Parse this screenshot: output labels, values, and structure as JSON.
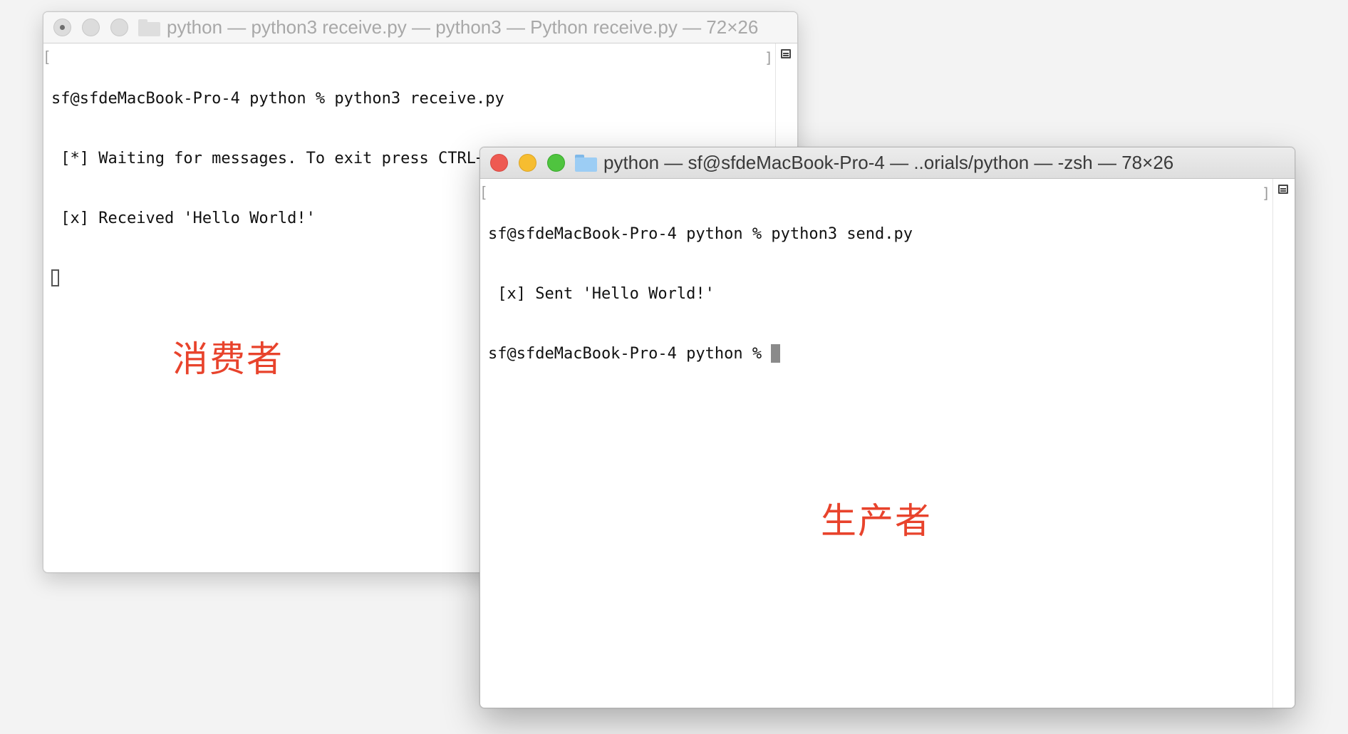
{
  "receiver_window": {
    "title": "python — python3 receive.py — python3 — Python receive.py — 72×26",
    "lines": [
      "sf@sfdeMacBook-Pro-4 python % python3 receive.py",
      " [*] Waiting for messages. To exit press CTRL+C",
      " [x] Received 'Hello World!'"
    ]
  },
  "sender_window": {
    "title": "python — sf@sfdeMacBook-Pro-4 — ..orials/python — -zsh — 78×26",
    "lines": [
      "sf@sfdeMacBook-Pro-4 python % python3 send.py",
      " [x] Sent 'Hello World!'"
    ],
    "prompt": "sf@sfdeMacBook-Pro-4 python % "
  },
  "annotations": {
    "consumer": "消费者",
    "producer": "生产者"
  },
  "colors": {
    "annotation": "#e8432c",
    "close": "#ee5a52",
    "minimize": "#f6bd30",
    "zoom": "#4fc43f"
  },
  "icons": [
    "folder-icon",
    "split-pane-icon"
  ]
}
